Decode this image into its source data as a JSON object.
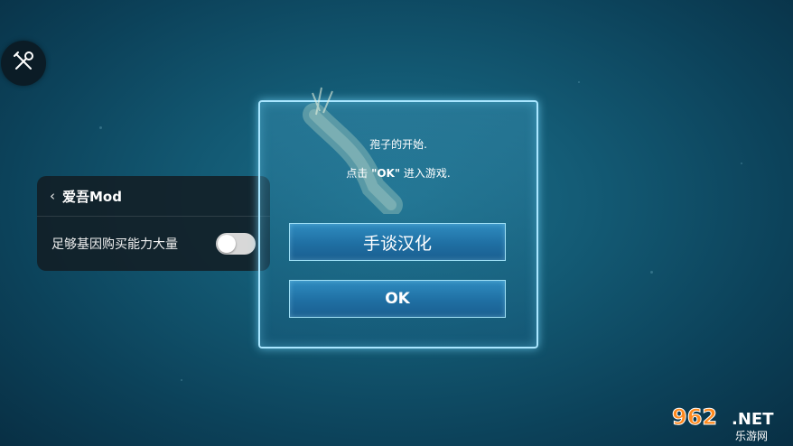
{
  "background": {
    "accent": "#135a74"
  },
  "tool_button": {
    "icon": "wrench-screwdriver-icon"
  },
  "mod_panel": {
    "back_icon": "‹",
    "title": "爱吾Mod",
    "options": [
      {
        "label": "足够基因购买能力大量",
        "toggle_on": false
      }
    ]
  },
  "dialog": {
    "line1": "孢子的开始.",
    "line2_prefix": "点击 ",
    "line2_emphasis": "\"OK\"",
    "line2_suffix": " 进入游戏.",
    "translate_button": "手谈汉化",
    "ok_button": "OK"
  },
  "watermark": {
    "top": "962.NET",
    "bottom": "乐游网"
  }
}
